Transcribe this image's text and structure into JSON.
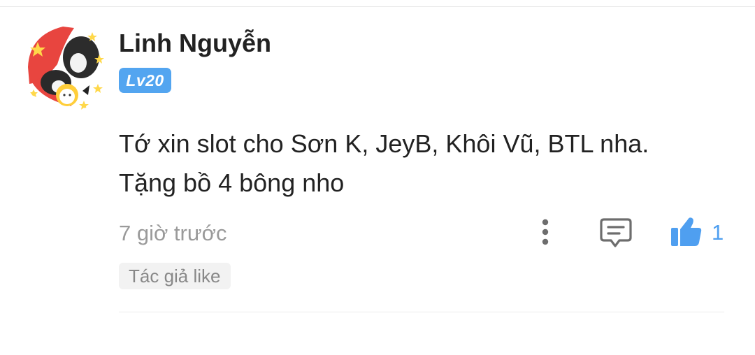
{
  "comment": {
    "username": "Linh Nguyễn",
    "level": "Lv20",
    "lines": [
      "Tớ xin slot cho Sơn K, JeyB, Khôi Vũ, BTL nha.",
      "Tặng bồ 4 bông nho"
    ],
    "timestamp": "7 giờ trước",
    "like_count": "1",
    "author_like_label": "Tác giả like"
  },
  "icons": {
    "avatar": "avatar-image",
    "more": "more-vertical-icon",
    "reply": "comment-icon",
    "like": "thumbs-up-icon"
  },
  "colors": {
    "accent": "#53a5f0",
    "like": "#4f9ff0",
    "muted_text": "#9a9a9a",
    "icon_gray": "#6d6d6d"
  }
}
